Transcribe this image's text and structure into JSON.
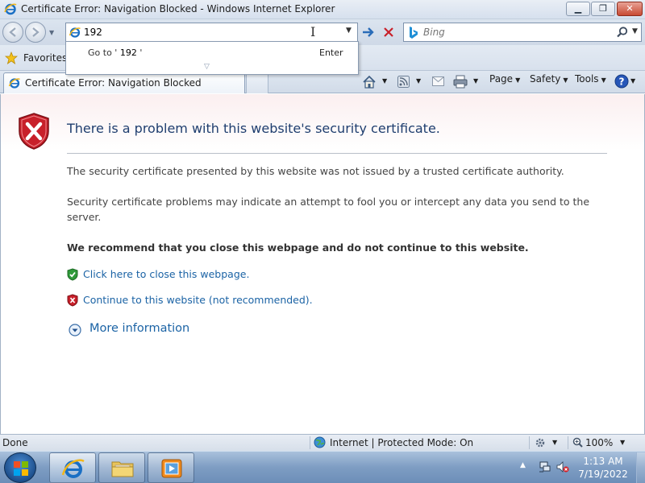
{
  "window": {
    "title": "Certificate Error: Navigation Blocked - Windows Internet Explorer",
    "minimize_glyph": "▁",
    "maximize_glyph": "❐",
    "close_glyph": "✕"
  },
  "address_bar": {
    "value": "192",
    "autocomplete": {
      "goto_prefix": "Go to '",
      "goto_value": " 192 ",
      "goto_suffix": "'",
      "enter_label": "Enter"
    }
  },
  "search": {
    "placeholder": "Bing"
  },
  "favorites": {
    "label": "Favorites"
  },
  "tab": {
    "label": "Certificate Error: Navigation Blocked"
  },
  "command_bar": {
    "page_label": "Page",
    "safety_label": "Safety",
    "tools_label": "Tools"
  },
  "content": {
    "title": "There is a problem with this website's security certificate.",
    "paragraph1": "The security certificate presented by this website was not issued by a trusted certificate authority.",
    "paragraph2": "Security certificate problems may indicate an attempt to fool you or intercept any data you send to the server.",
    "recommendation": "We recommend that you close this webpage and do not continue to this website.",
    "close_link": "Click here to close this webpage.",
    "continue_link": "Continue to this website (not recommended).",
    "more_info": "More information"
  },
  "status_bar": {
    "status": "Done",
    "zone": "Internet | Protected Mode: On",
    "zoom": "100%"
  },
  "taskbar": {
    "time": "1:13 AM",
    "date": "7/19/2022"
  },
  "colors": {
    "link": "#1b63a5",
    "title_blue": "#1f3e6f",
    "error_red": "#c8202a",
    "safe_green": "#2f9a3a"
  },
  "icons": {
    "app": "ie-icon",
    "back": "back-arrow-icon",
    "forward": "forward-arrow-icon",
    "go": "go-arrow-icon",
    "stop": "stop-x-icon",
    "search": "magnifier-icon",
    "favorites": "star-icon",
    "home": "home-icon",
    "feeds": "rss-icon",
    "mail": "mail-icon",
    "print": "printer-icon",
    "help": "help-icon",
    "error_shield": "shield-error-icon",
    "safe_shield": "shield-check-icon",
    "more_info": "expand-circle-icon",
    "zone": "globe-icon",
    "zoom": "zoom-icon"
  }
}
